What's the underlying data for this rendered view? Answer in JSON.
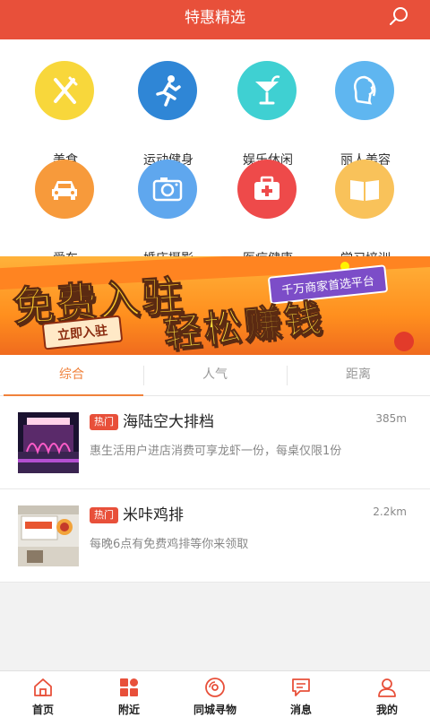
{
  "header": {
    "title": "特惠精选",
    "search_icon": "search-icon"
  },
  "colors": {
    "accent": "#e8503a",
    "tab_active": "#f0823c"
  },
  "categories": [
    {
      "label": "美食",
      "icon": "fork-knife-icon",
      "color": "#f8d73b"
    },
    {
      "label": "运动健身",
      "icon": "running-icon",
      "color": "#2f86d6"
    },
    {
      "label": "娱乐休闲",
      "icon": "cocktail-icon",
      "color": "#3fd0d2"
    },
    {
      "label": "丽人美容",
      "icon": "woman-profile-icon",
      "color": "#5fb6f0"
    },
    {
      "label": "爱车",
      "icon": "car-icon",
      "color": "#f79a3b"
    },
    {
      "label": "婚庆摄影",
      "icon": "camera-icon",
      "color": "#5fa7ee"
    },
    {
      "label": "医疗健康",
      "icon": "medical-kit-icon",
      "color": "#ee4a4a"
    },
    {
      "label": "学习培训",
      "icon": "book-icon",
      "color": "#f9c25a"
    }
  ],
  "banner": {
    "headline1": "免费入驻",
    "headline2": "轻松赚钱",
    "tag": "千万商家首选平台",
    "button": "立即入驻"
  },
  "tabs": [
    {
      "label": "综合",
      "active": true
    },
    {
      "label": "人气",
      "active": false
    },
    {
      "label": "距离",
      "active": false
    }
  ],
  "list": [
    {
      "badge": "热门",
      "name": "海陆空大排档",
      "distance": "385m",
      "desc": "惠生活用户进店消费可享龙虾一份，每桌仅限1份",
      "thumb": "restaurant-night-photo"
    },
    {
      "badge": "热门",
      "name": "米咔鸡排",
      "distance": "2.2km",
      "desc": "每晚6点有免费鸡排等你来领取",
      "thumb": "shop-front-photo"
    }
  ],
  "bottom_nav": [
    {
      "label": "首页",
      "icon": "home-icon"
    },
    {
      "label": "附近",
      "icon": "nearby-grid-icon"
    },
    {
      "label": "同城寻物",
      "icon": "disc-icon"
    },
    {
      "label": "消息",
      "icon": "message-icon"
    },
    {
      "label": "我的",
      "icon": "user-icon"
    }
  ]
}
